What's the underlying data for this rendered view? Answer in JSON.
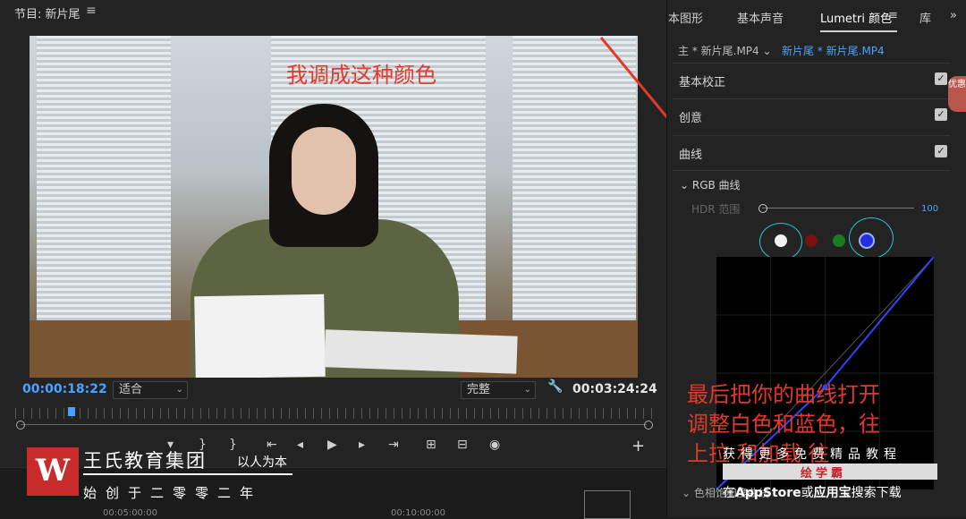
{
  "program_monitor": {
    "title": "节目: 新片尾",
    "menu_icon": "≡",
    "overlay_caption": "我调成这种颜色",
    "timecode_current": "00:00:18:22",
    "fit_select": "适合",
    "quality_select": "完整",
    "timecode_duration": "00:03:24:24",
    "timeline_times": [
      "00:05:00:00",
      "00:10:00:00"
    ]
  },
  "transport_icons": [
    "mark-in-icon",
    "mark-out-icon",
    "go-to-in-icon",
    "step-back-icon",
    "play-icon",
    "step-forward-icon",
    "go-to-out-icon",
    "lift-icon",
    "extract-icon",
    "export-frame-icon"
  ],
  "watermark": {
    "logo_letter": "W",
    "company": "王氏教育集团",
    "slogan": "以人为本",
    "founded": "始创于二零零二年"
  },
  "right_panel": {
    "tabs": [
      "本图形",
      "基本声音",
      "Lumetri 颜色",
      "库"
    ],
    "tab_menu_icon": "≡",
    "overflow_icon": "»",
    "source_master": "主 * 新片尾.MP4",
    "source_sequence": "新片尾 * 新片尾.MP4",
    "sections": [
      {
        "label": "基本校正",
        "checked": true
      },
      {
        "label": "创意",
        "checked": true
      },
      {
        "label": "曲线",
        "checked": true
      }
    ],
    "rgb_curves_label": "RGB 曲线",
    "hdr_label": "HDR 范围",
    "hdr_value": "100",
    "channels": [
      "white",
      "red",
      "green",
      "blue"
    ],
    "channel_colors": {
      "white": "#f2f2f2",
      "red": "#7a1010",
      "green": "#1c7a23",
      "blue": "#2430e0"
    },
    "curve_points": [
      [
        0,
        0
      ],
      [
        0.5,
        0.44
      ],
      [
        1,
        1
      ]
    ],
    "color_wheel_label": "色相饱和度曲线",
    "overlay_caption_lines": [
      "最后把你的曲线打开",
      "调整白色和蓝色，往",
      "上拉 和加载    往"
    ],
    "promo_line1": "获得更多免费精品教程",
    "promo_brand": "绘学霸",
    "promo_line2_prefix": "在",
    "promo_store": "AppStore",
    "promo_or": "或",
    "promo_app": "应用宝",
    "promo_line2_suffix": "搜索下载",
    "side_badge": "优惠"
  },
  "colors": {
    "accent_blue": "#4aa3ff",
    "annotation_red": "#e23a2a",
    "brand_red": "#c72c2a"
  }
}
